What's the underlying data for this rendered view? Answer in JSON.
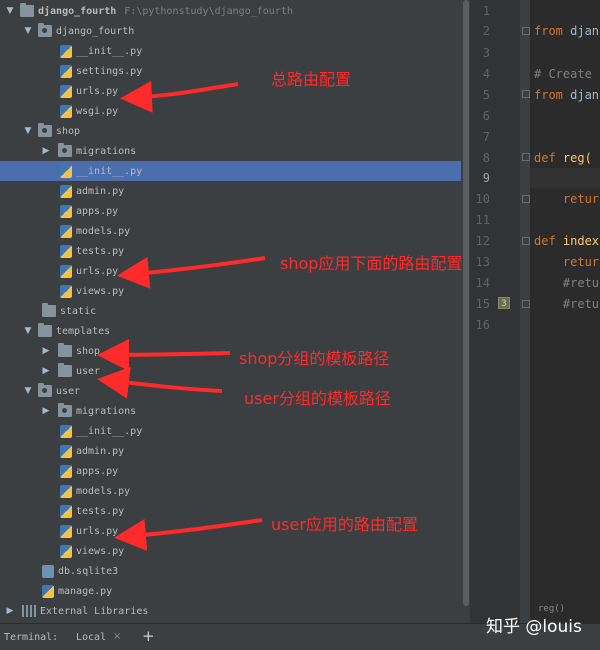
{
  "project": {
    "name": "django_fourth",
    "path": "F:\\pythonstudy\\django_fourth",
    "items": [
      {
        "label": "django_fourth",
        "kind": "package",
        "expanded": true
      },
      {
        "label": "__init__.py",
        "kind": "py"
      },
      {
        "label": "settings.py",
        "kind": "py"
      },
      {
        "label": "urls.py",
        "kind": "py"
      },
      {
        "label": "wsgi.py",
        "kind": "py"
      },
      {
        "label": "shop",
        "kind": "package",
        "expanded": true
      },
      {
        "label": "migrations",
        "kind": "package",
        "expanded": false
      },
      {
        "label": "__init__.py",
        "kind": "py",
        "selected": true
      },
      {
        "label": "admin.py",
        "kind": "py"
      },
      {
        "label": "apps.py",
        "kind": "py"
      },
      {
        "label": "models.py",
        "kind": "py"
      },
      {
        "label": "tests.py",
        "kind": "py"
      },
      {
        "label": "urls.py",
        "kind": "py"
      },
      {
        "label": "views.py",
        "kind": "py"
      },
      {
        "label": "static",
        "kind": "folder"
      },
      {
        "label": "templates",
        "kind": "folder",
        "expanded": true
      },
      {
        "label": "shop",
        "kind": "folder",
        "expanded": false
      },
      {
        "label": "user",
        "kind": "folder",
        "expanded": false
      },
      {
        "label": "user",
        "kind": "package",
        "expanded": true
      },
      {
        "label": "migrations",
        "kind": "package",
        "expanded": false
      },
      {
        "label": "__init__.py",
        "kind": "py"
      },
      {
        "label": "admin.py",
        "kind": "py"
      },
      {
        "label": "apps.py",
        "kind": "py"
      },
      {
        "label": "models.py",
        "kind": "py"
      },
      {
        "label": "tests.py",
        "kind": "py"
      },
      {
        "label": "urls.py",
        "kind": "py"
      },
      {
        "label": "views.py",
        "kind": "py"
      },
      {
        "label": "db.sqlite3",
        "kind": "db"
      },
      {
        "label": "manage.py",
        "kind": "py"
      },
      {
        "label": "External Libraries",
        "kind": "libraries",
        "expanded": false
      }
    ]
  },
  "annotations": {
    "main_urls": "总路由配置",
    "shop_urls": "shop应用下面的路由配置",
    "shop_templates": "shop分组的模板路径",
    "user_templates": "user分组的模板路径",
    "user_urls": "user应用的路由配置"
  },
  "editor": {
    "line_numbers": [
      "1",
      "2",
      "3",
      "4",
      "5",
      "6",
      "7",
      "8",
      "9",
      "10",
      "11",
      "12",
      "13",
      "14",
      "15",
      "16"
    ],
    "current_line": "9",
    "lines": {
      "l2_kw": "from",
      "l2_rest": " djan",
      "l4": "# Create",
      "l5_kw": "from",
      "l5_rest": " djan",
      "l8_kw": "def",
      "l8_fn": " reg(",
      "l10": "    retur",
      "l12_kw": "def",
      "l12_fn": " index",
      "l13": "    retur",
      "l14": "    #retu",
      "l15": "    #retu"
    },
    "marker": "3",
    "breadcrumb": "reg()"
  },
  "terminal": {
    "label": "Terminal:",
    "tab": "Local",
    "close": "×",
    "add": "+"
  },
  "watermark": "知乎 @louis"
}
